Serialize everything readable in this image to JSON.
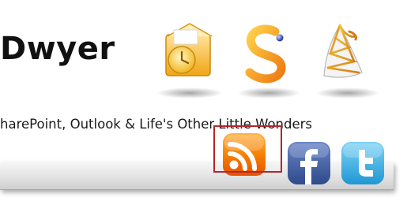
{
  "header": {
    "site_title": "Dwyer",
    "tagline": "harePoint, Outlook & Life's Other Little Wonders"
  },
  "product_icons": [
    {
      "icon": "outlook-icon",
      "color": "#f2b21c"
    },
    {
      "icon": "sharepoint-icon",
      "color": "#f08a1c"
    },
    {
      "icon": "sql-server-icon",
      "color": "#e0a020"
    }
  ],
  "social_icons": [
    {
      "icon": "rss-icon",
      "color": "#f57c00",
      "highlighted": true
    },
    {
      "icon": "facebook-icon",
      "color": "#3b5998"
    },
    {
      "icon": "twitter-icon",
      "color": "#29a9e1"
    }
  ],
  "colors": {
    "highlight_border": "#b3262c",
    "nav_bar": "#e2e2e2"
  }
}
